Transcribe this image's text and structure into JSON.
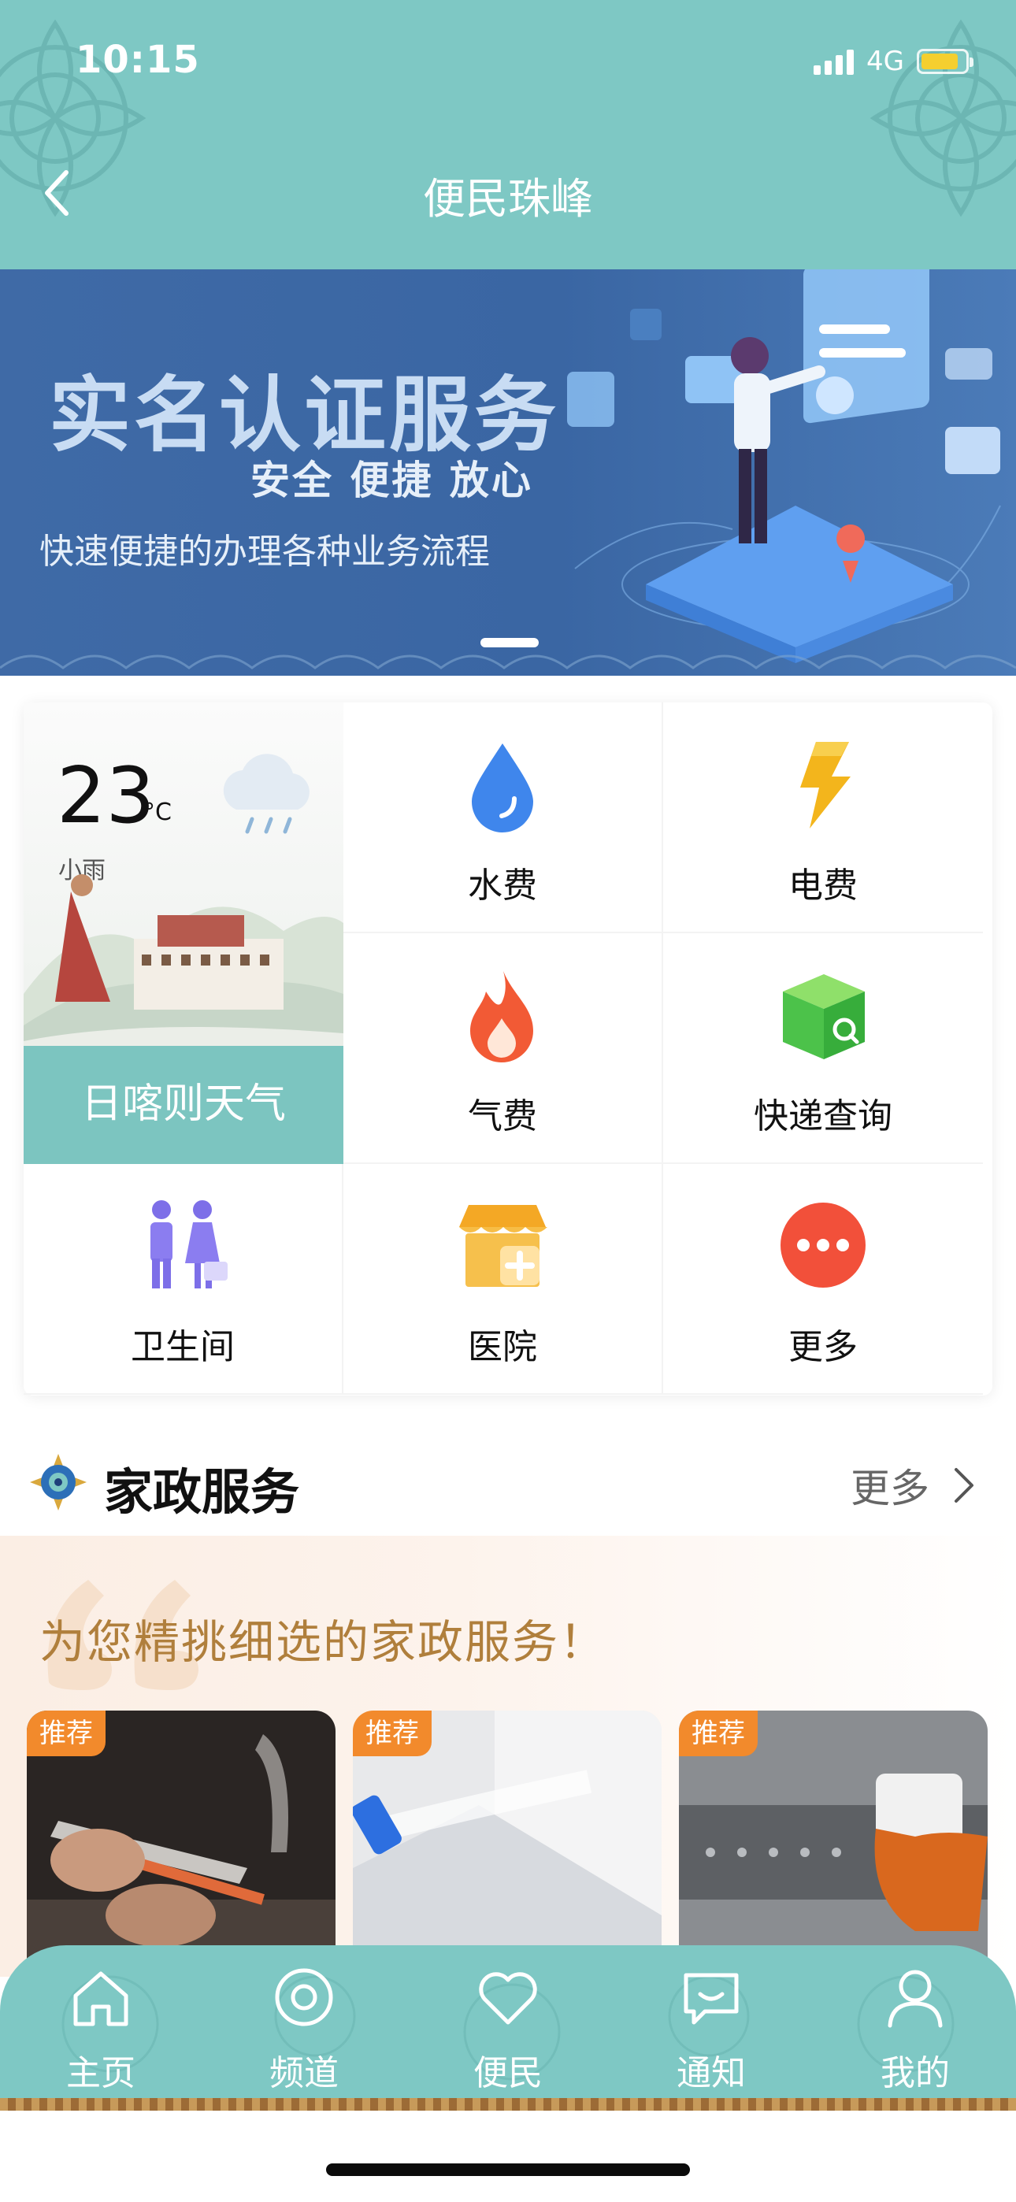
{
  "status_bar": {
    "time": "10:15",
    "network": "4G",
    "battery_level": 0.85,
    "signal_bars": 4
  },
  "header": {
    "title": "便民珠峰",
    "back_icon": "chevron-left-icon"
  },
  "banner": {
    "headline": "实名认证服务",
    "tagline": "安全  便捷  放心",
    "subtitle": "快速便捷的办理各种业务流程",
    "page_count": 1,
    "active_page": 1
  },
  "weather": {
    "temperature": "23",
    "unit": "°C",
    "condition": "小雨",
    "city": "日喀则天气",
    "icon": "rain-cloud-icon"
  },
  "services": [
    {
      "label": "水费",
      "icon": "water-drop-icon"
    },
    {
      "label": "电费",
      "icon": "lightning-icon"
    },
    {
      "label": "气费",
      "icon": "flame-icon"
    },
    {
      "label": "快递查询",
      "icon": "package-search-icon"
    },
    {
      "label": "卫生间",
      "icon": "restroom-icon"
    },
    {
      "label": "医院",
      "icon": "hospital-icon"
    },
    {
      "label": "更多",
      "icon": "more-dots-icon"
    }
  ],
  "section": {
    "title": "家政服务",
    "more_label": "更多",
    "emblem": "emblem-icon"
  },
  "promo": {
    "text": "为您精挑细选的家政服务！",
    "cards": [
      {
        "tag": "推荐",
        "image": "plumbing-repair-photo"
      },
      {
        "tag": "推荐",
        "image": "cleaning-spray-photo"
      },
      {
        "tag": "推荐",
        "image": "range-hood-cleaning-photo"
      }
    ]
  },
  "tabbar": {
    "tabs": [
      {
        "label": "主页",
        "icon": "home-icon"
      },
      {
        "label": "频道",
        "icon": "channel-icon"
      },
      {
        "label": "便民",
        "icon": "heart-icon"
      },
      {
        "label": "通知",
        "icon": "message-icon"
      },
      {
        "label": "我的",
        "icon": "profile-icon"
      }
    ]
  },
  "colors": {
    "primary_teal": "#7ec8c4",
    "banner_blue": "#3f6aa6",
    "tag_orange": "#f28a2c",
    "promo_text": "#b07f3c"
  }
}
